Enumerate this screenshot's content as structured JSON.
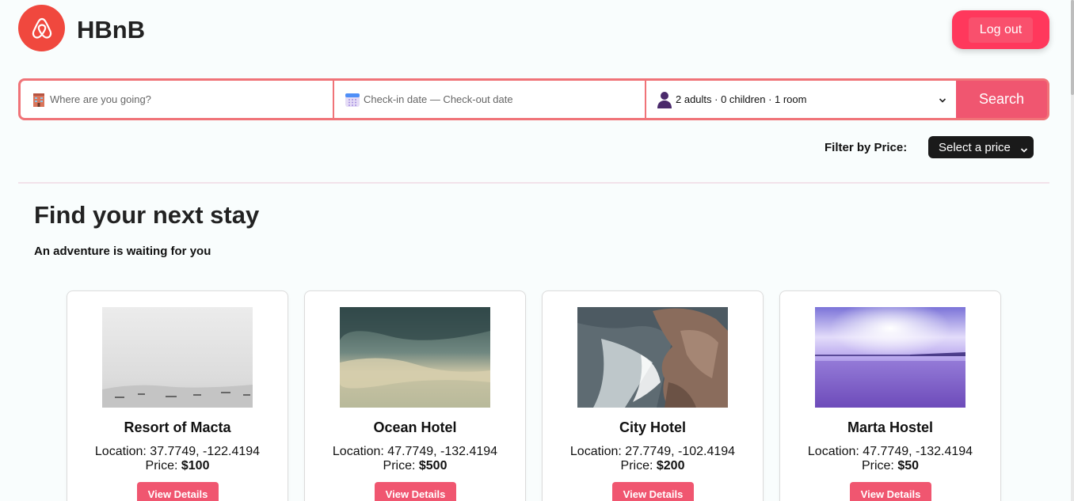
{
  "brand": {
    "name": "HBnB",
    "color": "#f0483e"
  },
  "header": {
    "logout_label": "Log out"
  },
  "search": {
    "where_placeholder": "Where are you going?",
    "dates_placeholder": "Check-in date — Check-out date",
    "guests_value": "2 adults · 0 children · 1 room",
    "button_label": "Search",
    "accent_color": "#f07378"
  },
  "filter": {
    "label": "Filter by Price:",
    "select_value": "Select a price"
  },
  "main": {
    "title": "Find your next stay",
    "subtitle": "An adventure is waiting for you"
  },
  "places": [
    {
      "name": "Resort of Macta",
      "location_label": "Location: 37.7749, -122.4194",
      "price_label": "Price:",
      "price": "$100",
      "button_label": "View Details",
      "image": "foggy-harbor-photo"
    },
    {
      "name": "Ocean Hotel",
      "location_label": "Location: 47.7749, -132.4194",
      "price_label": "Price:",
      "price": "$500",
      "button_label": "View Details",
      "image": "cloudy-sky-photo"
    },
    {
      "name": "City Hotel",
      "location_label": "Location: 27.7749, -102.4194",
      "price_label": "Price:",
      "price": "$200",
      "button_label": "View Details",
      "image": "rocky-coast-waves-photo"
    },
    {
      "name": "Marta Hostel",
      "location_label": "Location: 47.7749, -132.4194",
      "price_label": "Price:",
      "price": "$50",
      "button_label": "View Details",
      "image": "purple-sunset-bay-photo"
    }
  ]
}
